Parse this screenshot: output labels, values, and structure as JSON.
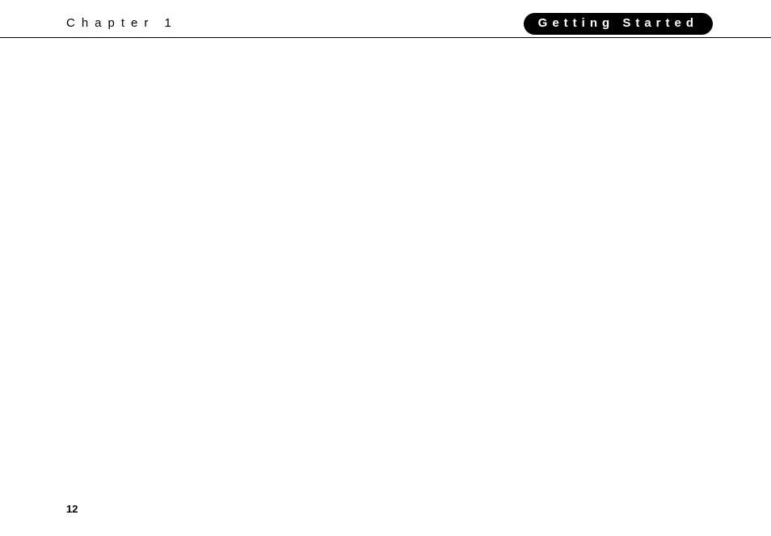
{
  "header": {
    "chapter_label": "Chapter 1",
    "section_title": "Getting Started"
  },
  "footer": {
    "page_number": "12"
  }
}
